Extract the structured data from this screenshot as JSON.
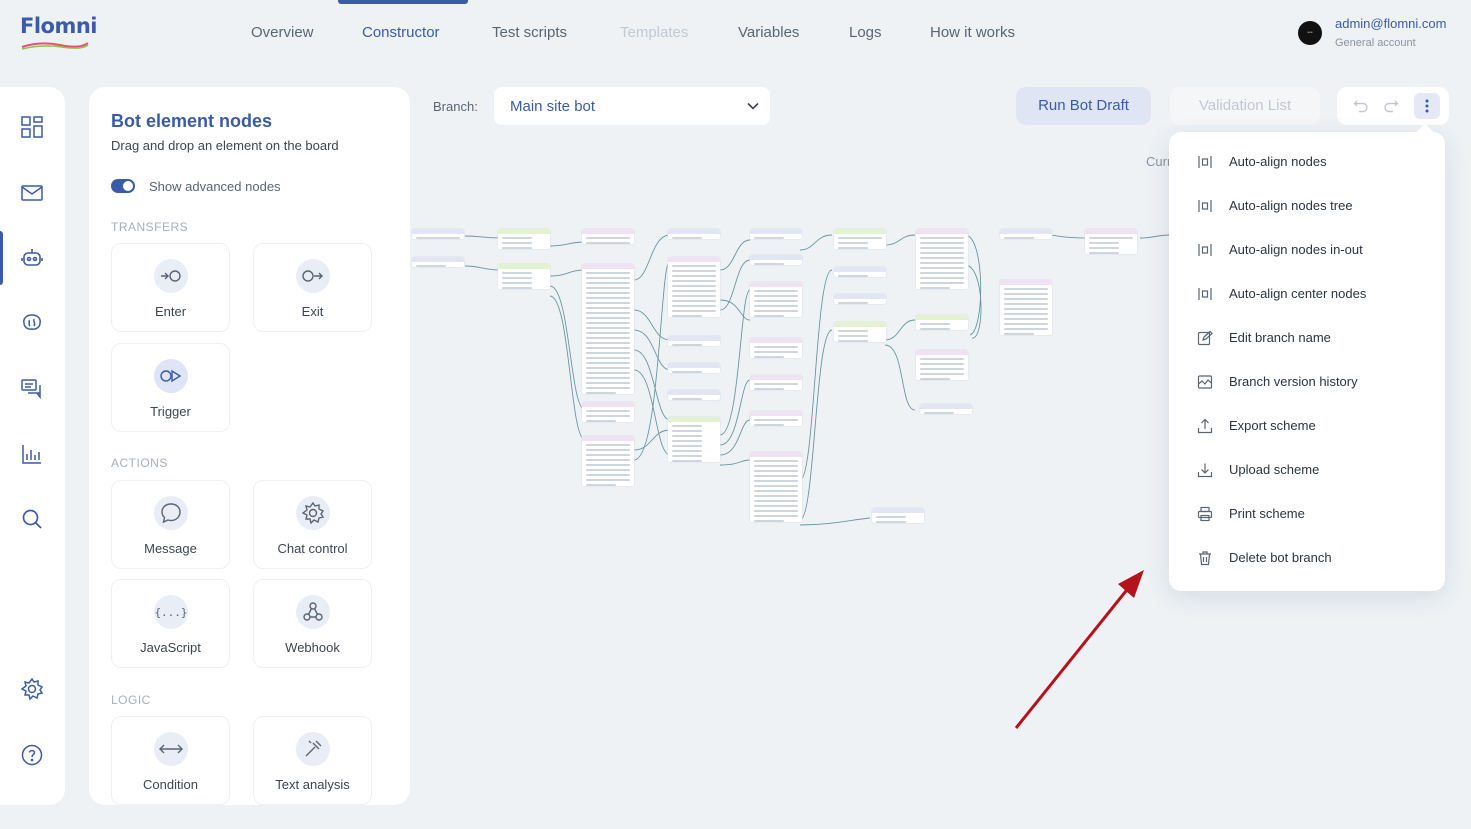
{
  "brand": {
    "logo_text": "Flomni"
  },
  "nav": {
    "items": [
      {
        "label": "Overview",
        "state": "normal"
      },
      {
        "label": "Constructor",
        "state": "active"
      },
      {
        "label": "Test scripts",
        "state": "normal"
      },
      {
        "label": "Templates",
        "state": "disabled"
      },
      {
        "label": "Variables",
        "state": "normal"
      },
      {
        "label": "Logs",
        "state": "normal"
      },
      {
        "label": "How it works",
        "state": "normal"
      }
    ]
  },
  "account": {
    "email": "admin@flomni.com",
    "subtitle": "General account"
  },
  "rail": {
    "icons": [
      "dashboard-icon",
      "mail-icon",
      "bot-icon",
      "brain-icon",
      "chat-icon",
      "chart-icon",
      "search-icon",
      "settings-icon",
      "help-icon"
    ]
  },
  "palette": {
    "title": "Bot element nodes",
    "subtitle": "Drag and drop an element on the board",
    "toggle_label": "Show advanced nodes",
    "toggle_on": true,
    "sections": {
      "transfers": "TRANSFERS",
      "actions": "ACTIONS",
      "logic": "LOGIC"
    },
    "tiles": {
      "enter": "Enter",
      "exit": "Exit",
      "trigger": "Trigger",
      "message": "Message",
      "chat_control": "Chat control",
      "javascript": "JavaScript",
      "webhook": "Webhook",
      "condition": "Condition",
      "text_analysis": "Text analysis"
    }
  },
  "toolbar": {
    "branch_label": "Branch:",
    "branch_value": "Main site bot",
    "run_label": "Run Bot Draft",
    "validation_label": "Validation List",
    "cur_text": "Curr"
  },
  "menu": {
    "items": [
      {
        "label": "Auto-align nodes",
        "icon": "align-icon"
      },
      {
        "label": "Auto-align nodes tree",
        "icon": "align-icon"
      },
      {
        "label": "Auto-align nodes in-out",
        "icon": "align-icon"
      },
      {
        "label": "Auto-align center nodes",
        "icon": "align-icon"
      },
      {
        "label": "Edit branch name",
        "icon": "edit-icon"
      },
      {
        "label": "Branch version history",
        "icon": "history-icon"
      },
      {
        "label": "Export scheme",
        "icon": "export-icon"
      },
      {
        "label": "Upload scheme",
        "icon": "upload-icon"
      },
      {
        "label": "Print scheme",
        "icon": "print-icon"
      },
      {
        "label": "Delete bot branch",
        "icon": "trash-icon"
      }
    ]
  },
  "colors": {
    "accent": "#3a5ba8",
    "annotation_arrow": "#b5121b"
  }
}
